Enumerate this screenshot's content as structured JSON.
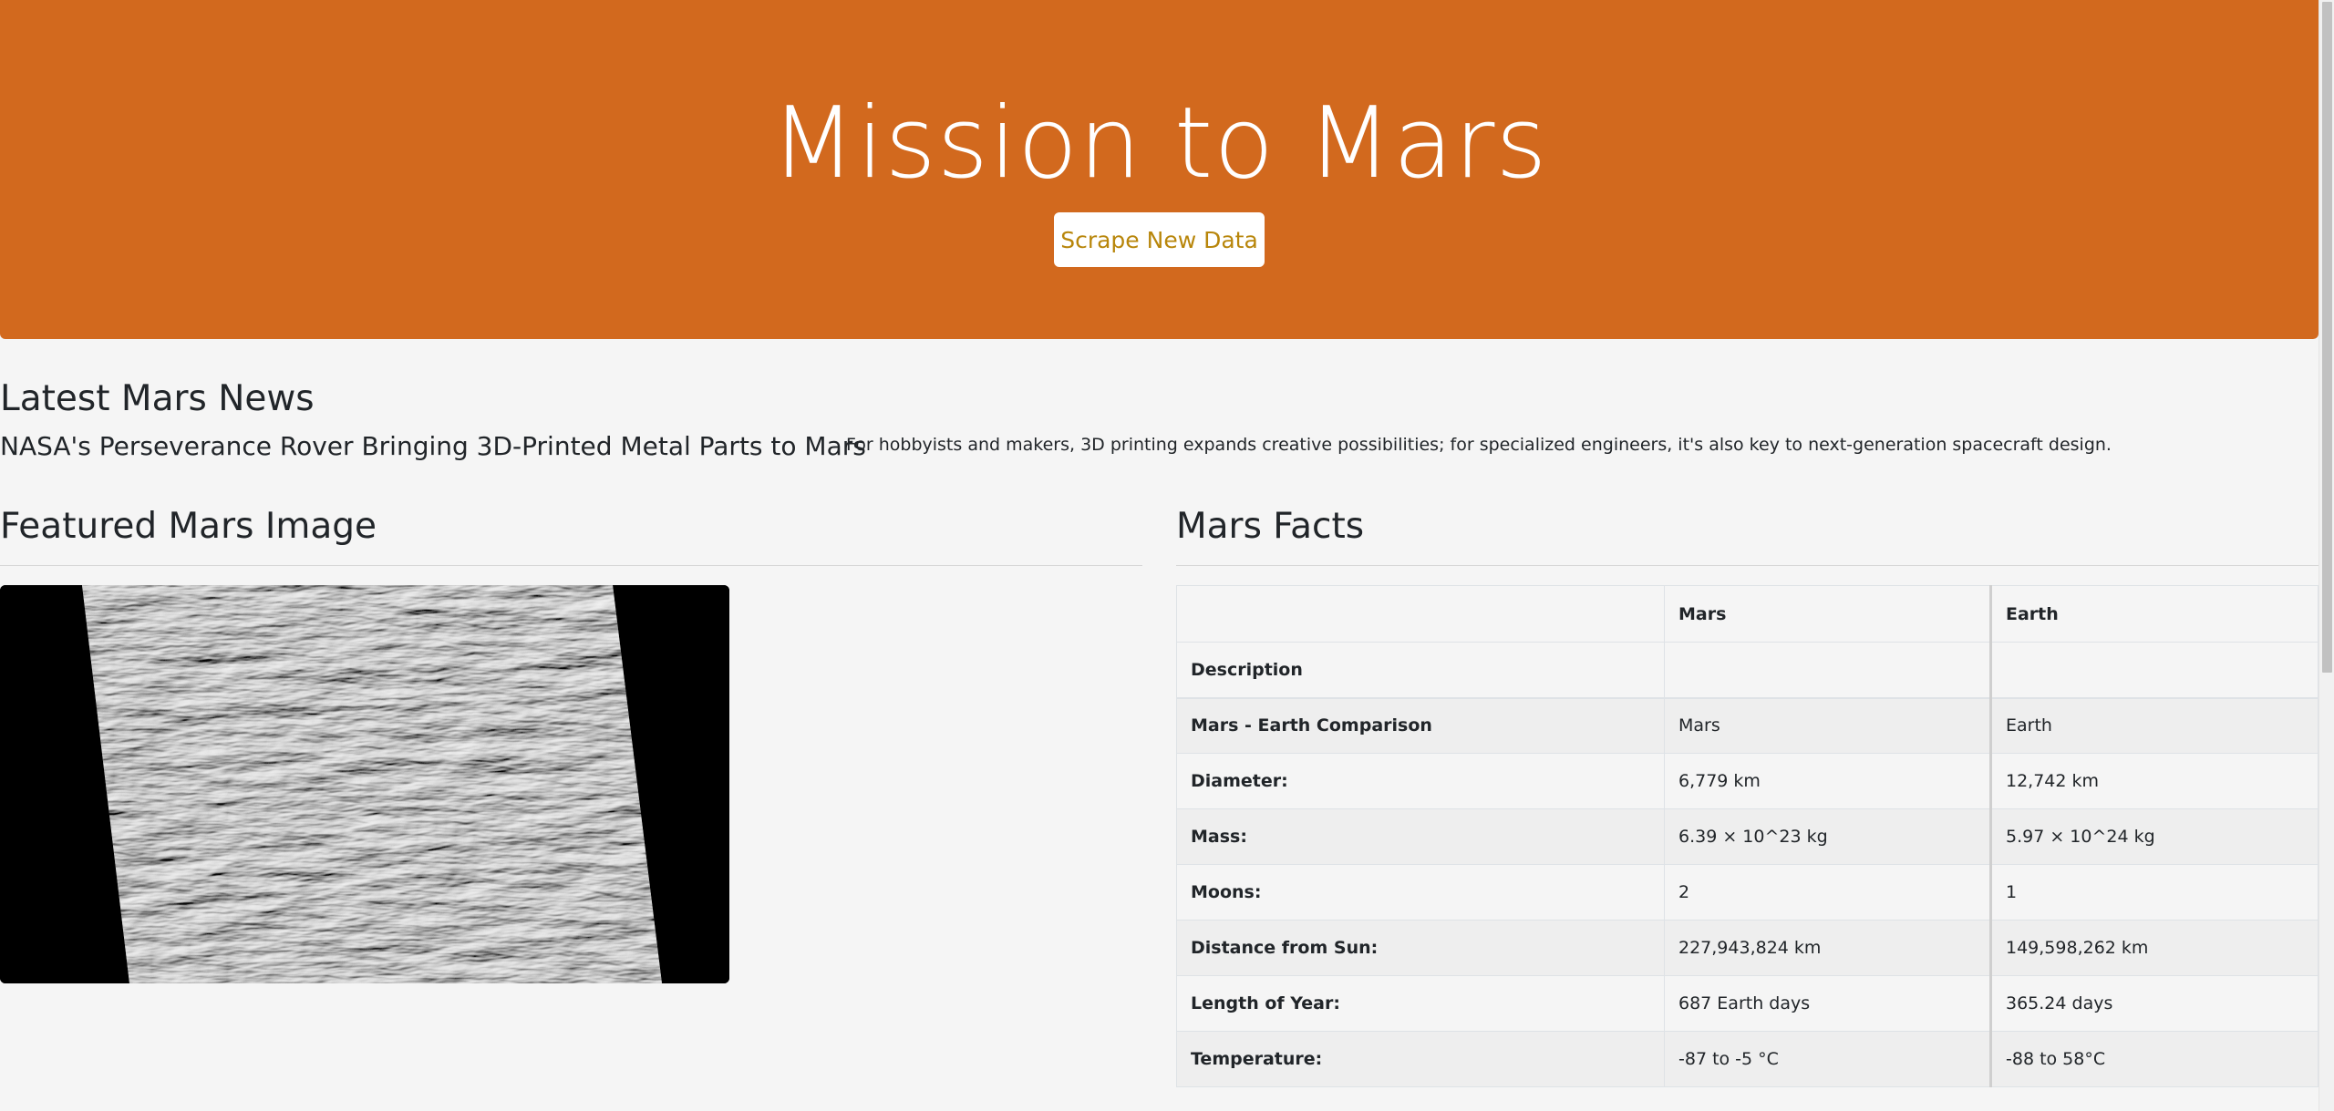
{
  "header": {
    "title": "Mission to Mars",
    "scrape_button_label": "Scrape New Data"
  },
  "news": {
    "heading": "Latest Mars News",
    "title": "NASA's Perseverance Rover Bringing 3D-Printed Metal Parts to Mars",
    "teaser": "For hobbyists and makers, 3D printing expands creative possibilities; for specialized engineers, it's also key to next-generation spacecraft design."
  },
  "featured": {
    "heading": "Featured Mars Image",
    "image_subject": "grayscale-mars-dunes"
  },
  "facts": {
    "heading": "Mars Facts",
    "columns": [
      "",
      "Mars",
      "Earth"
    ],
    "index_label": "Description",
    "rows": [
      {
        "label": "Mars - Earth Comparison",
        "mars": "Mars",
        "earth": "Earth"
      },
      {
        "label": "Diameter:",
        "mars": "6,779 km",
        "earth": "12,742 km"
      },
      {
        "label": "Mass:",
        "mars": "6.39 × 10^23 kg",
        "earth": "5.97 × 10^24 kg"
      },
      {
        "label": "Moons:",
        "mars": "2",
        "earth": "1"
      },
      {
        "label": "Distance from Sun:",
        "mars": "227,943,824 km",
        "earth": "149,598,262 km"
      },
      {
        "label": "Length of Year:",
        "mars": "687 Earth days",
        "earth": "365.24 days"
      },
      {
        "label": "Temperature:",
        "mars": "-87 to -5 °C",
        "earth": "-88 to 58°C"
      }
    ]
  },
  "colors": {
    "header_bg": "#d2691e",
    "button_text": "#b8860b",
    "page_bg": "#f5f5f5"
  }
}
